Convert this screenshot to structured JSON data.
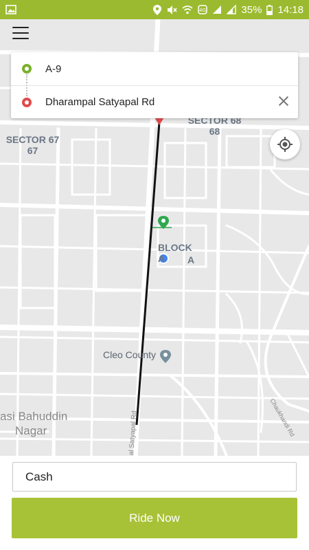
{
  "statusbar": {
    "battery": "35%",
    "time": "14:18",
    "icons": [
      "gallery-icon",
      "location-icon",
      "mute-icon",
      "wifi-icon",
      "data-icon",
      "signal-icon",
      "signal-icon",
      "battery-icon"
    ]
  },
  "map": {
    "labels": {
      "sector68_name": "SECTOR 68",
      "sector68_num": "68",
      "sector67_name": "SECTOR 67",
      "sector67_num": "67",
      "block_name": "BLOCK A",
      "block_sub": "A",
      "cleo": "Cleo County",
      "basi_line1": "asi Bahuddin",
      "basi_line2": "Nagar",
      "road_satyapal": "al Satyapal Rd",
      "road_chaukhandi": "Chaukhandi Rd"
    },
    "colors": {
      "background": "#e8e8e8",
      "streets": "#ffffff",
      "route": "#111111",
      "pickup": "#2fa84f",
      "drop": "#e04b4b",
      "current_location": "#4285f4",
      "poi": "#78909c"
    }
  },
  "route_card": {
    "pickup": "A-9",
    "drop": "Dharampal Satyapal Rd"
  },
  "bottom": {
    "payment": "Cash",
    "ride_button": "Ride Now"
  },
  "colors": {
    "statusbar": "#9cba2f",
    "accent": "#a7c237"
  }
}
